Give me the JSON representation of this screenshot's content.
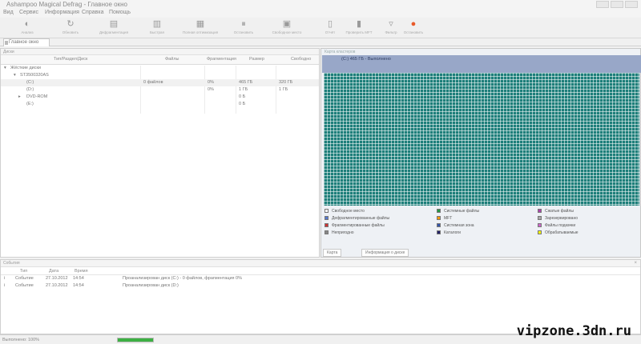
{
  "app": {
    "title": "Ashampoo Magical Defrag - Главное окно"
  },
  "menu": [
    "Вид",
    "Сервис",
    "Информация",
    "Справка",
    "Помощь"
  ],
  "toolbar": [
    {
      "label": "Анализ",
      "icon": "analyze-icon"
    },
    {
      "label": "Обновить",
      "icon": "refresh-icon"
    },
    {
      "label": "Дефрагментация",
      "icon": "defrag-icon"
    },
    {
      "label": "Быстрая",
      "icon": "fast-icon"
    },
    {
      "label": "Полная оптимизация",
      "icon": "optimize-icon"
    },
    {
      "label": "Остановить",
      "icon": "pause-icon"
    },
    {
      "label": "Свободное место",
      "icon": "free-space-icon"
    },
    {
      "label": "Отчёт",
      "icon": "report-icon"
    },
    {
      "label": "Проверить MFT",
      "icon": "mft-icon"
    },
    {
      "label": "Фильтр",
      "icon": "filter-icon"
    },
    {
      "label": "Остановить",
      "icon": "stop-icon"
    }
  ],
  "tabs": [
    "Главное окно"
  ],
  "left_pane": {
    "caption": "Диски",
    "columns": [
      "Тип/Раздел/Диск",
      "Файлы",
      "Фрагментация",
      "Размер",
      "Свободно"
    ],
    "rows": [
      {
        "name": "Жёсткие диски",
        "files": "",
        "frag": "",
        "size": "",
        "free": ""
      },
      {
        "name": "ST3500320AS",
        "files": "",
        "frag": "",
        "size": "",
        "free": ""
      },
      {
        "name": "(C:)",
        "files": "0 файлов",
        "frag": "0%",
        "size": "465 ГБ",
        "free": "320 ГБ"
      },
      {
        "name": "(D:)",
        "files": "",
        "frag": "0%",
        "size": "1 ГБ",
        "free": "1 ГБ"
      },
      {
        "name": "DVD-ROM",
        "files": "",
        "frag": "",
        "size": "0 Б",
        "free": ""
      },
      {
        "name": "(E:)",
        "files": "",
        "frag": "",
        "size": "0 Б",
        "free": ""
      }
    ]
  },
  "right_pane": {
    "caption": "Карта кластеров",
    "map_title": "(C:) 465 ГБ - Выполнено",
    "legend": [
      {
        "text": "Свободное место",
        "color": "#ffffff"
      },
      {
        "text": "Дефрагментированные файлы",
        "color": "#5577cc"
      },
      {
        "text": "Фрагментированные файлы",
        "color": "#cc3333"
      },
      {
        "text": "Непригодно",
        "color": "#888888"
      },
      {
        "text": "Системные файлы",
        "color": "#229944"
      },
      {
        "text": "MFT",
        "color": "#ff9900"
      },
      {
        "text": "Системная зона",
        "color": "#3355aa"
      },
      {
        "text": "Каталоги",
        "color": "#222266"
      },
      {
        "text": "Сжатые файлы",
        "color": "#aa44aa"
      },
      {
        "text": "Зарезервировано",
        "color": "#aaaaaa"
      },
      {
        "text": "Файлы подкачки",
        "color": "#cc66cc"
      },
      {
        "text": "Обрабатываемые",
        "color": "#ffff00"
      }
    ],
    "tabs": [
      "Карта",
      "Информация о диске"
    ]
  },
  "log": {
    "caption": "События",
    "columns": [
      "Тип",
      "Дата",
      "Время"
    ],
    "rows": [
      {
        "type": "Событие",
        "date": "27.10.2012",
        "time": "14:54",
        "msg": "Проанализирован диск (C:) - 0 файлов, фрагментация 0%"
      },
      {
        "type": "Событие",
        "date": "27.10.2012",
        "time": "14:54",
        "msg": "Проанализирован диск (D:)"
      }
    ]
  },
  "status": {
    "text": "Выполнено: 100%",
    "progress": 1.0
  },
  "watermark": "vipzone.3dn.ru"
}
